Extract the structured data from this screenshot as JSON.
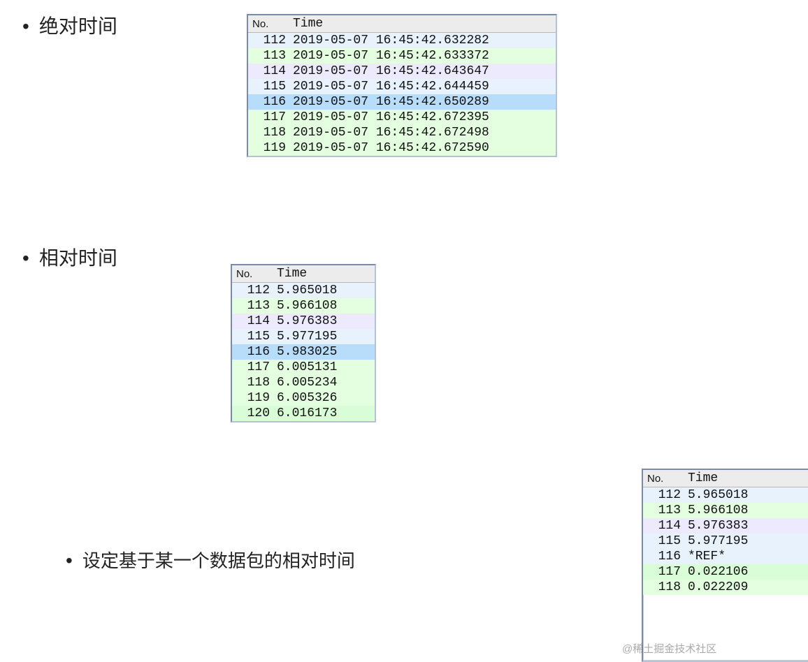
{
  "bullets": {
    "absolute": "绝对时间",
    "relative": "相对时间",
    "ref": "设定基于某一个数据包的相对时间"
  },
  "headers": {
    "no": "No.",
    "time": "Time"
  },
  "table_absolute": [
    {
      "no": "112",
      "time": "2019-05-07 16:45:42.632282",
      "color": "lightblue"
    },
    {
      "no": "113",
      "time": "2019-05-07 16:45:42.633372",
      "color": "green"
    },
    {
      "no": "114",
      "time": "2019-05-07 16:45:42.643647",
      "color": "lavender"
    },
    {
      "no": "115",
      "time": "2019-05-07 16:45:42.644459",
      "color": "lightblue"
    },
    {
      "no": "116",
      "time": "2019-05-07 16:45:42.650289",
      "color": "skyblue"
    },
    {
      "no": "117",
      "time": "2019-05-07 16:45:42.672395",
      "color": "green"
    },
    {
      "no": "118",
      "time": "2019-05-07 16:45:42.672498",
      "color": "green"
    },
    {
      "no": "119",
      "time": "2019-05-07 16:45:42.672590",
      "color": "green"
    }
  ],
  "table_relative": [
    {
      "no": "112",
      "time": "5.965018",
      "color": "lightblue"
    },
    {
      "no": "113",
      "time": "5.966108",
      "color": "green"
    },
    {
      "no": "114",
      "time": "5.976383",
      "color": "lavender"
    },
    {
      "no": "115",
      "time": "5.977195",
      "color": "lightblue"
    },
    {
      "no": "116",
      "time": "5.983025",
      "color": "skyblue"
    },
    {
      "no": "117",
      "time": "6.005131",
      "color": "green"
    },
    {
      "no": "118",
      "time": "6.005234",
      "color": "green"
    },
    {
      "no": "119",
      "time": "6.005326",
      "color": "green"
    },
    {
      "no": "120",
      "time": "6.016173",
      "color": "green2"
    }
  ],
  "table_ref": [
    {
      "no": "112",
      "time": "5.965018",
      "color": "lightblue"
    },
    {
      "no": "113",
      "time": "5.966108",
      "color": "green"
    },
    {
      "no": "114",
      "time": "5.976383",
      "color": "lavender"
    },
    {
      "no": "115",
      "time": "5.977195",
      "color": "lightblue"
    },
    {
      "no": "116",
      "time": "*REF*",
      "color": "lightblue"
    },
    {
      "no": "117",
      "time": "0.022106",
      "color": "green2"
    },
    {
      "no": "118",
      "time": "0.022209",
      "color": "green"
    }
  ],
  "watermark": "@稀土掘金技术社区"
}
